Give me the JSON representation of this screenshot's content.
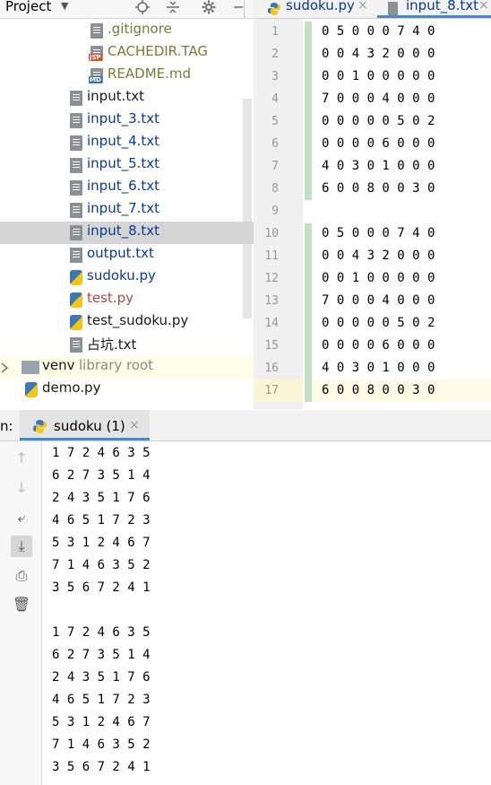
{
  "project": {
    "title": "Project",
    "caret": "▼",
    "header_icons": [
      "locate-icon",
      "collapse-icon",
      "gear-icon",
      "minimize-icon"
    ],
    "tree": [
      {
        "label": ".gitignore",
        "kind": "gitignore",
        "color": "olive"
      },
      {
        "label": "CACHEDIR.TAG",
        "kind": "jsp",
        "badge": "JSP",
        "color": "olive"
      },
      {
        "label": "README.md",
        "kind": "md",
        "badge": "MD",
        "color": "olive"
      },
      {
        "label": "input.txt",
        "kind": "txt",
        "color": "dark"
      },
      {
        "label": "input_3.txt",
        "kind": "txt",
        "color": "blue"
      },
      {
        "label": "input_4.txt",
        "kind": "txt",
        "color": "blue"
      },
      {
        "label": "input_5.txt",
        "kind": "txt",
        "color": "blue"
      },
      {
        "label": "input_6.txt",
        "kind": "txt",
        "color": "blue"
      },
      {
        "label": "input_7.txt",
        "kind": "txt",
        "color": "blue"
      },
      {
        "label": "input_8.txt",
        "kind": "txt",
        "color": "blue",
        "selected": true
      },
      {
        "label": "output.txt",
        "kind": "txt",
        "color": "blue"
      },
      {
        "label": "sudoku.py",
        "kind": "py",
        "color": "blue"
      },
      {
        "label": "test.py",
        "kind": "py",
        "color": "red"
      },
      {
        "label": "test_sudoku.py",
        "kind": "py",
        "color": "dark"
      },
      {
        "label": "占坑.txt",
        "kind": "txt",
        "color": "dark"
      }
    ],
    "venv": {
      "label": "venv",
      "suffix": "library root"
    },
    "demo": {
      "label": "demo.py"
    }
  },
  "editor": {
    "tabs": [
      {
        "label": "sudoku.py",
        "close": "×"
      },
      {
        "label": "input_8.txt",
        "close": "×",
        "active": true
      }
    ],
    "line_numbers": [
      "1",
      "2",
      "3",
      "4",
      "5",
      "6",
      "7",
      "8",
      "9",
      "10",
      "11",
      "12",
      "13",
      "14",
      "15",
      "16",
      "17"
    ],
    "lines": [
      "0 5 0 0 0 7 4 0",
      "0 0 4 3 2 0 0 0",
      "0 0 1 0 0 0 0 0",
      "7 0 0 0 4 0 0 0",
      "0 0 0 0 0 5 0 2",
      "0 0 0 0 6 0 0 0",
      "4 0 3 0 1 0 0 0",
      "6 0 0 8 0 0 3 0",
      "",
      "0 5 0 0 0 7 4 0",
      "0 0 4 3 2 0 0 0",
      "0 0 1 0 0 0 0 0",
      "7 0 0 0 4 0 0 0",
      "0 0 0 0 0 5 0 2",
      "0 0 0 0 6 0 0 0",
      "4 0 3 0 1 0 0 0",
      "6 0 0 8 0 0 3 0"
    ]
  },
  "run": {
    "label": "n:",
    "tab_label": "sudoku (1)",
    "tab_close": "×",
    "toolbar": [
      {
        "name": "up-arrow-icon",
        "glyph": "↑",
        "dim": true
      },
      {
        "name": "down-arrow-icon",
        "glyph": "↓",
        "dim": true
      },
      {
        "name": "soft-wrap-icon",
        "glyph": "⤶"
      },
      {
        "name": "scroll-to-end-icon",
        "glyph": "⤓",
        "active": true
      },
      {
        "name": "print-icon",
        "glyph": "⎙"
      },
      {
        "name": "trash-icon",
        "glyph": "🗑"
      }
    ],
    "output": [
      "1 7 2 4 6 3 5",
      "6 2 7 3 5 1 4",
      "2 4 3 5 1 7 6",
      "4 6 5 1 7 2 3",
      "5 3 1 2 4 6 7",
      "7 1 4 6 3 5 2",
      "3 5 6 7 2 4 1",
      "",
      "1 7 2 4 6 3 5",
      "6 2 7 3 5 1 4",
      "2 4 3 5 1 7 6",
      "4 6 5 1 7 2 3",
      "5 3 1 2 4 6 7",
      "7 1 4 6 3 5 2",
      "3 5 6 7 2 4 1"
    ]
  },
  "colors": {
    "accent": "#4a88c7",
    "file_blue": "#0a3a93",
    "file_red": "#b8463d",
    "file_olive": "#7a7a3a",
    "selection": "#d5d5d5"
  }
}
